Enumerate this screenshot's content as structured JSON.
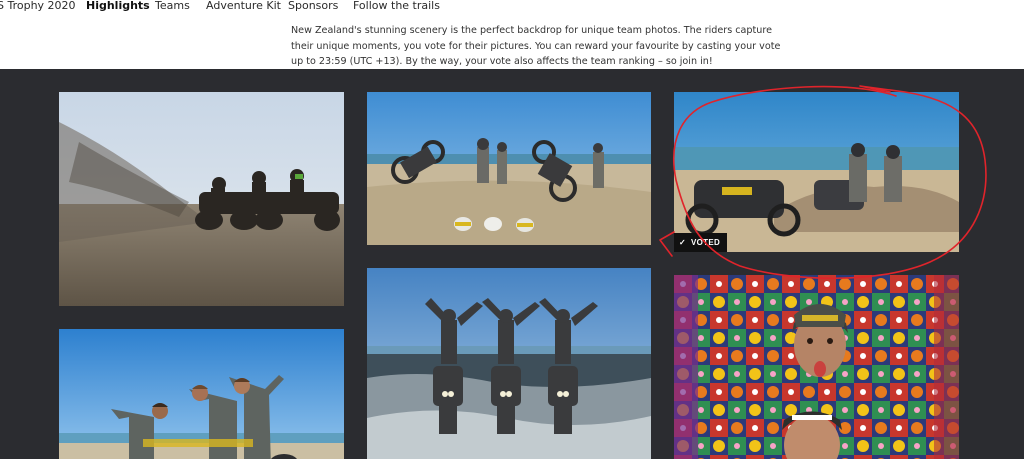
{
  "nav": {
    "items": [
      {
        "label": "S Trophy 2020"
      },
      {
        "label": "Highlights",
        "active": true
      },
      {
        "label": "Teams"
      },
      {
        "label": "Adventure Kit"
      },
      {
        "label": "Sponsors"
      },
      {
        "label": "Follow the trails"
      }
    ]
  },
  "intro": {
    "lines": [
      "New Zealand's stunning scenery is the perfect backdrop for unique team photos. The riders capture",
      "their unique moments, you vote for their pictures. You can reward your favourite by casting your vote",
      "up to 23:59 (UTC +13). By the way, your vote also affects the team ranking – so join in!"
    ]
  },
  "gallery": {
    "background": "#2b2c30",
    "voted_label": "VOTED",
    "photos": [
      {
        "name": "photo-beach-spray-riders"
      },
      {
        "name": "photo-beach-wheelies-team"
      },
      {
        "name": "photo-voted-bikes-rocks",
        "voted": true
      },
      {
        "name": "photo-team-waving-beach"
      },
      {
        "name": "photo-riders-standing-on-bikes-surf"
      },
      {
        "name": "photo-riders-faces-colorful-rug"
      }
    ]
  },
  "annotation": {
    "color": "#e0242b"
  }
}
